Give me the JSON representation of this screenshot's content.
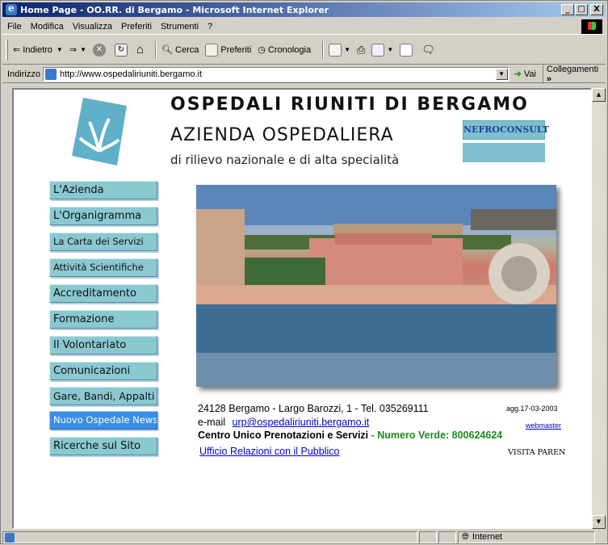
{
  "window": {
    "title": "Home Page - OO.RR. di Bergamo - Microsoft Internet Explorer",
    "controls": [
      "_",
      "□",
      "X"
    ]
  },
  "menu": [
    "File",
    "Modifica",
    "Visualizza",
    "Preferiti",
    "Strumenti",
    "?"
  ],
  "toolbar": {
    "back": "Indietro",
    "search": "Cerca",
    "favorites": "Preferiti",
    "history": "Cronologia"
  },
  "address": {
    "label": "Indirizzo",
    "url": "http://www.ospedaliriuniti.bergamo.it",
    "go": "Vai",
    "links": "Collegamenti"
  },
  "page": {
    "title": "OSPEDALI RIUNITI DI BERGAMO",
    "subtitle": "AZIENDA OSPEDALIERA",
    "tagline": "di rilievo nazionale e di alta specialità",
    "nefro": "NEFROCONSULT",
    "nav": [
      "L'Azienda",
      "L'Organigramma",
      "La Carta dei Servizi",
      "Attività Scientifiche",
      "Accreditamento",
      "Formazione",
      "Il Volontariato",
      "Comunicazioni",
      "Gare, Bandi, Appalti",
      "Nuovo Ospedale News",
      "Ricerche sul Sito"
    ],
    "address_line": "24128  Bergamo  -  Largo Barozzi, 1 -  Tel. 035269111",
    "updated": "agg.17-03-2003",
    "email_label": "e-mail",
    "email": "urp@ospedaliriuniti.bergamo.it",
    "webmaster": "webmaster",
    "cup_label": "Centro Unico Prenotazioni e Servizi",
    "dash": " - ",
    "verde": "Numero Verde: 800624624",
    "urp": "Ufficio Relazioni con il Pubblico",
    "visita": "VISITA PAREN"
  },
  "status": {
    "zone": "Internet"
  },
  "colors": {
    "nav_bg": "#8ac8d2",
    "nav_active": "#3b8ee8",
    "green": "#1c8a1c",
    "title_bar": "#0a246a"
  }
}
